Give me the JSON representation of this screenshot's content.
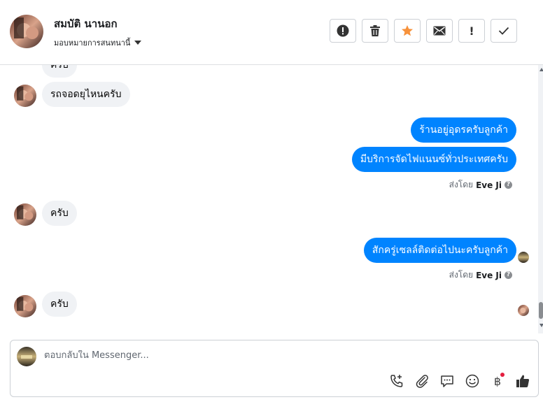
{
  "header": {
    "contact_name": "สมบัติ นานอก",
    "assign_label": "มอบหมายการสนทนานี้"
  },
  "toolbar": {
    "buttons": [
      "report-spam",
      "delete",
      "star",
      "mark-unread",
      "follow-up",
      "mark-done"
    ],
    "follow_up_glyph": "!"
  },
  "messages": [
    {
      "from": "customer",
      "text": "ครับ"
    },
    {
      "from": "customer",
      "text": "รถจอดยุไหนครับ"
    },
    {
      "from": "page",
      "text": "ร้านอยู่อุดรครับลูกค้า"
    },
    {
      "from": "page",
      "text": "มีบริการจัดไฟแนนซ์ทั่วประเทศครับ"
    },
    {
      "from": "customer",
      "text": "ครับ"
    },
    {
      "from": "page",
      "text": "สักครู่เซลล์ติดต่อไปนะครับลูกค้า"
    },
    {
      "from": "customer",
      "text": "ครับ"
    }
  ],
  "sent_by": {
    "prefix": "ส่งโดย",
    "name": "Eve Ji",
    "help_glyph": "?"
  },
  "composer": {
    "placeholder": "ตอบกลับใน Messenger...",
    "currency_glyph": "฿",
    "icons": [
      "phone-add-icon",
      "paperclip-icon",
      "speech-bubble-icon",
      "emoji-icon",
      "baht-icon",
      "thumbs-up-icon"
    ]
  },
  "colors": {
    "outgoing_bubble": "#0084ff",
    "incoming_bubble": "#f0f2f5",
    "star": "#f7923b",
    "notification_dot": "#e41e3f"
  }
}
